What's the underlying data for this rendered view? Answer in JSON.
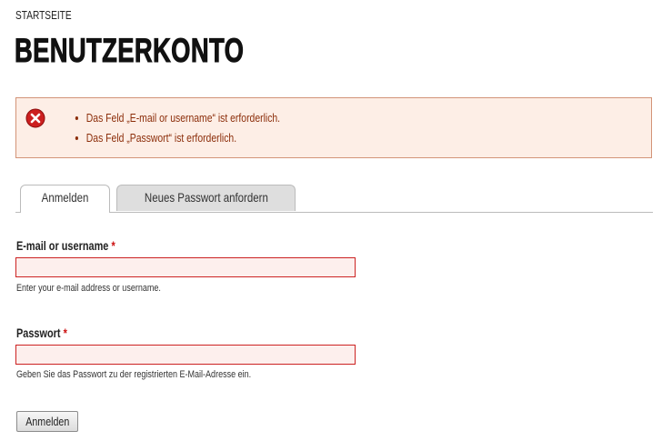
{
  "breadcrumb": {
    "home": "STARTSEITE"
  },
  "page": {
    "title": "BENUTZERKONTO"
  },
  "messages": {
    "icon": "error-icon",
    "color": "#8c2e0b",
    "background": "#fdeee6",
    "errors": [
      "Das Feld „E-mail or username“ ist erforderlich.",
      "Das Feld „Passwort“ ist erforderlich."
    ]
  },
  "tabs": [
    {
      "label": "Anmelden",
      "active": true
    },
    {
      "label": "Neues Passwort anfordern",
      "active": false
    }
  ],
  "form": {
    "username": {
      "label": "E-mail or username",
      "required_marker": "*",
      "value": "",
      "description": "Enter your e-mail address or username."
    },
    "password": {
      "label": "Passwort",
      "required_marker": "*",
      "value": "",
      "description": "Geben Sie das Passwort zu der registrierten E-Mail-Adresse ein."
    },
    "submit_label": "Anmelden"
  }
}
